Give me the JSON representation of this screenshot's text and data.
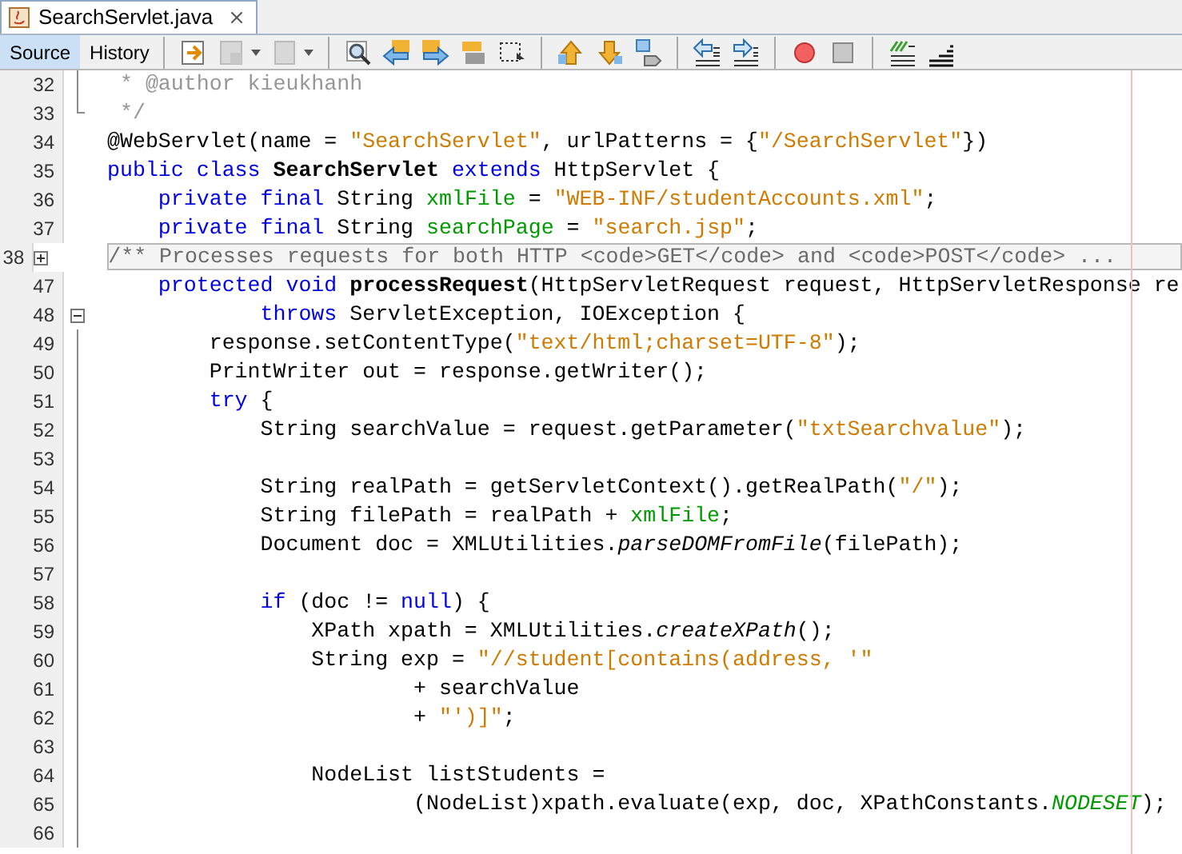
{
  "file_tab": {
    "title": "SearchServlet.java",
    "selected": true
  },
  "view_tabs": [
    {
      "label": "Source",
      "selected": true
    },
    {
      "label": "History",
      "selected": false
    }
  ],
  "lines": [
    {
      "number": "32",
      "in_block": true,
      "tokens": [
        {
          "kind": "comment",
          "text": " * @author kieukhanh"
        }
      ]
    },
    {
      "number": "33",
      "block_end": true,
      "tokens": [
        {
          "kind": "comment",
          "text": " */"
        }
      ]
    },
    {
      "number": "34",
      "tokens": [
        {
          "kind": "plain",
          "text": "@WebServlet(name = "
        },
        {
          "kind": "string",
          "text": "\"SearchServlet\""
        },
        {
          "kind": "plain",
          "text": ", urlPatterns = {"
        },
        {
          "kind": "string",
          "text": "\"/SearchServlet\""
        },
        {
          "kind": "plain",
          "text": "})"
        }
      ]
    },
    {
      "number": "35",
      "tokens": [
        {
          "kind": "keyword",
          "text": "public class "
        },
        {
          "kind": "bold",
          "text": "SearchServlet"
        },
        {
          "kind": "keyword",
          "text": " extends "
        },
        {
          "kind": "plain",
          "text": "HttpServlet {"
        }
      ]
    },
    {
      "number": "36",
      "tokens": [
        {
          "kind": "keyword",
          "text": "    private final "
        },
        {
          "kind": "plain",
          "text": "String "
        },
        {
          "kind": "field",
          "text": "xmlFile"
        },
        {
          "kind": "plain",
          "text": " = "
        },
        {
          "kind": "string",
          "text": "\"WEB-INF/studentAccounts.xml\""
        },
        {
          "kind": "plain",
          "text": ";"
        }
      ]
    },
    {
      "number": "37",
      "tokens": [
        {
          "kind": "keyword",
          "text": "    private final "
        },
        {
          "kind": "plain",
          "text": "String "
        },
        {
          "kind": "field",
          "text": "searchPage"
        },
        {
          "kind": "plain",
          "text": " = "
        },
        {
          "kind": "string",
          "text": "\"search.jsp\""
        },
        {
          "kind": "plain",
          "text": ";"
        }
      ]
    },
    {
      "number": "38",
      "fold": {
        "expanded": false
      },
      "tokens": [
        {
          "kind": "folded",
          "text": "/** Processes requests for both HTTP <code>GET</code> and <code>POST</code> ..."
        }
      ]
    },
    {
      "number": "47",
      "tokens": [
        {
          "kind": "keyword",
          "text": "    protected void "
        },
        {
          "kind": "bold",
          "text": "processRequest"
        },
        {
          "kind": "plain",
          "text": "(HttpServletRequest request, HttpServletResponse re"
        }
      ]
    },
    {
      "number": "48",
      "fold": {
        "expanded": true
      },
      "tokens": [
        {
          "kind": "keyword",
          "text": "            throws "
        },
        {
          "kind": "plain",
          "text": "ServletException, IOException {"
        }
      ]
    },
    {
      "number": "49",
      "in_block": true,
      "tokens": [
        {
          "kind": "plain",
          "text": "        response.setContentType("
        },
        {
          "kind": "string",
          "text": "\"text/html;charset=UTF-8\""
        },
        {
          "kind": "plain",
          "text": ");"
        }
      ]
    },
    {
      "number": "50",
      "in_block": true,
      "tokens": [
        {
          "kind": "plain",
          "text": "        PrintWriter out = response.getWriter();"
        }
      ]
    },
    {
      "number": "51",
      "in_block": true,
      "tokens": [
        {
          "kind": "keyword",
          "text": "        try "
        },
        {
          "kind": "plain",
          "text": "{"
        }
      ]
    },
    {
      "number": "52",
      "in_block": true,
      "tokens": [
        {
          "kind": "plain",
          "text": "            String searchValue = request.getParameter("
        },
        {
          "kind": "string",
          "text": "\"txtSearchvalue\""
        },
        {
          "kind": "plain",
          "text": ");"
        }
      ]
    },
    {
      "number": "53",
      "in_block": true
    },
    {
      "number": "54",
      "in_block": true,
      "tokens": [
        {
          "kind": "plain",
          "text": "            String realPath = getServletContext().getRealPath("
        },
        {
          "kind": "string",
          "text": "\"/\""
        },
        {
          "kind": "plain",
          "text": ");"
        }
      ]
    },
    {
      "number": "55",
      "in_block": true,
      "tokens": [
        {
          "kind": "plain",
          "text": "            String filePath = realPath + "
        },
        {
          "kind": "field",
          "text": "xmlFile"
        },
        {
          "kind": "plain",
          "text": ";"
        }
      ]
    },
    {
      "number": "56",
      "in_block": true,
      "tokens": [
        {
          "kind": "plain",
          "text": "            Document doc = XMLUtilities."
        },
        {
          "kind": "italic",
          "text": "parseDOMFromFile"
        },
        {
          "kind": "plain",
          "text": "(filePath);"
        }
      ]
    },
    {
      "number": "57",
      "in_block": true
    },
    {
      "number": "58",
      "in_block": true,
      "tokens": [
        {
          "kind": "keyword",
          "text": "            if "
        },
        {
          "kind": "plain",
          "text": "(doc != "
        },
        {
          "kind": "keyword",
          "text": "null"
        },
        {
          "kind": "plain",
          "text": ") {"
        }
      ]
    },
    {
      "number": "59",
      "in_block": true,
      "tokens": [
        {
          "kind": "plain",
          "text": "                XPath xpath = XMLUtilities."
        },
        {
          "kind": "italic",
          "text": "createXPath"
        },
        {
          "kind": "plain",
          "text": "();"
        }
      ]
    },
    {
      "number": "60",
      "in_block": true,
      "tokens": [
        {
          "kind": "plain",
          "text": "                String exp = "
        },
        {
          "kind": "string",
          "text": "\"//student[contains(address, '\""
        }
      ]
    },
    {
      "number": "61",
      "in_block": true,
      "tokens": [
        {
          "kind": "plain",
          "text": "                        + searchValue"
        }
      ]
    },
    {
      "number": "62",
      "in_block": true,
      "tokens": [
        {
          "kind": "plain",
          "text": "                        + "
        },
        {
          "kind": "string",
          "text": "\"')]\""
        },
        {
          "kind": "plain",
          "text": ";"
        }
      ]
    },
    {
      "number": "63",
      "in_block": true
    },
    {
      "number": "64",
      "in_block": true,
      "tokens": [
        {
          "kind": "plain",
          "text": "                NodeList listStudents ="
        }
      ]
    },
    {
      "number": "65",
      "in_block": true,
      "tokens": [
        {
          "kind": "plain",
          "text": "                        (NodeList)xpath.evaluate(exp, doc, XPathConstants."
        },
        {
          "kind": "static_field",
          "text": "NODESET"
        },
        {
          "kind": "plain",
          "text": ");"
        }
      ]
    },
    {
      "number": "66",
      "in_block": true
    }
  ]
}
